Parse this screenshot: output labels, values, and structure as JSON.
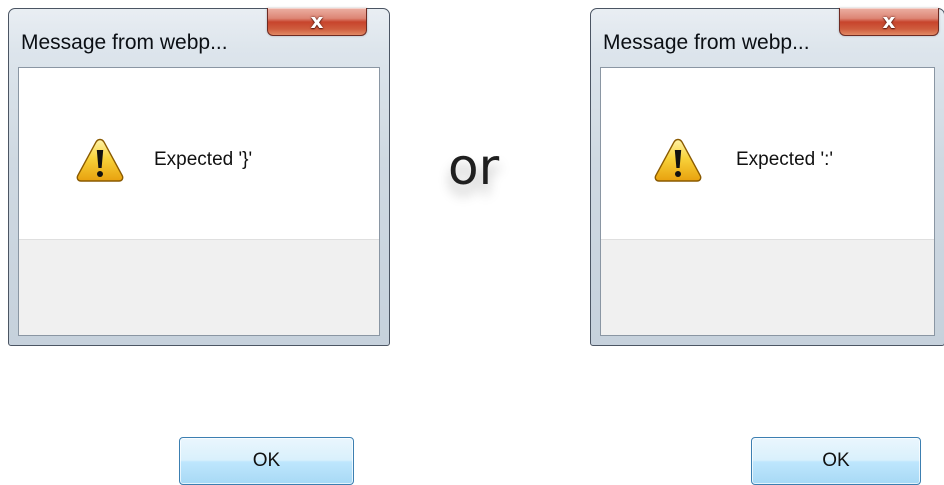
{
  "dialogs": [
    {
      "title": "Message from webp...",
      "message": "Expected '}'",
      "ok_label": "OK",
      "close_glyph": "x",
      "icon": "warning-icon"
    },
    {
      "title": "Message from webp...",
      "message": "Expected ':'",
      "ok_label": "OK",
      "close_glyph": "x",
      "icon": "warning-icon"
    }
  ],
  "separator": "or",
  "colors": {
    "close_button": "#c7442c",
    "ok_button": "#bee6fd",
    "ok_border": "#3c7fb1",
    "warning_fill": "#f5c21b"
  }
}
